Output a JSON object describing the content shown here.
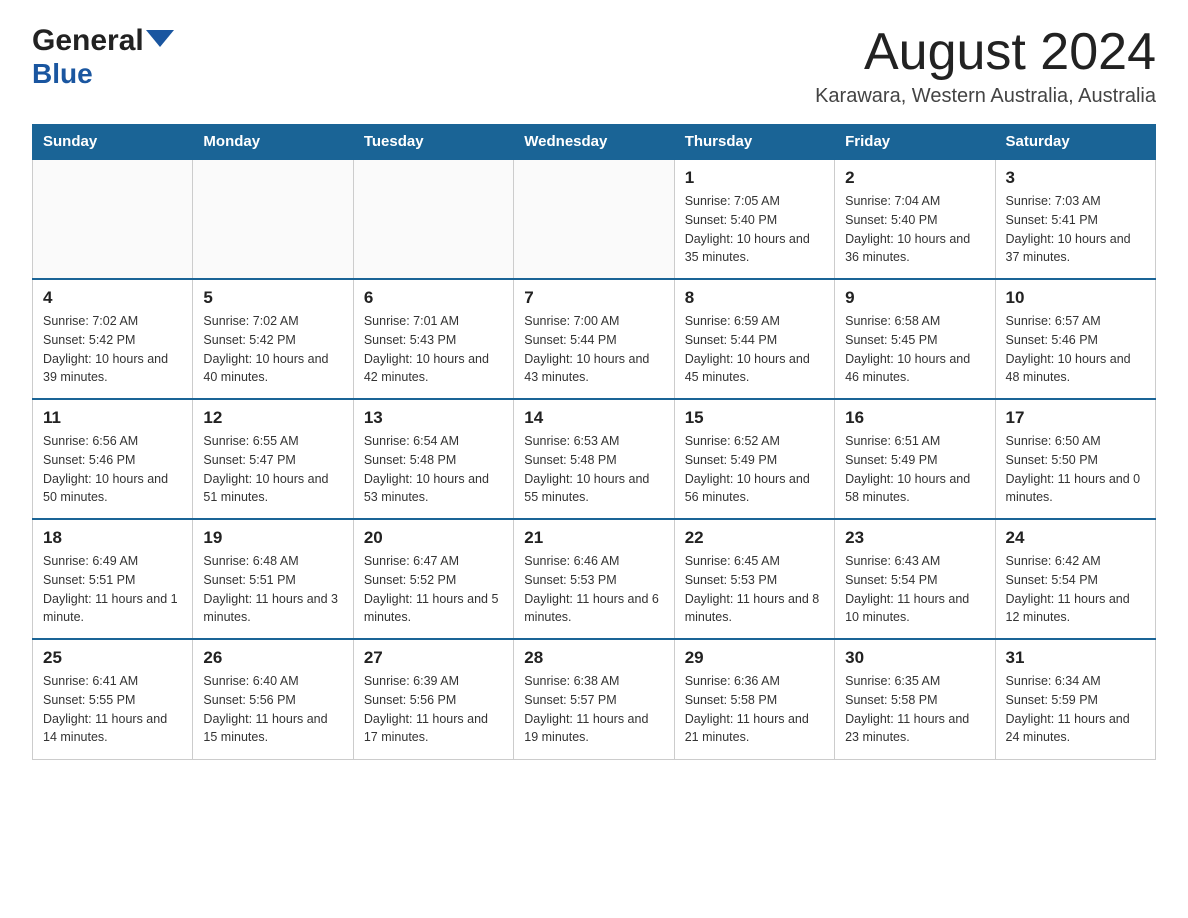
{
  "header": {
    "logo_general": "General",
    "logo_blue": "Blue",
    "main_title": "August 2024",
    "subtitle": "Karawara, Western Australia, Australia"
  },
  "calendar": {
    "days_of_week": [
      "Sunday",
      "Monday",
      "Tuesday",
      "Wednesday",
      "Thursday",
      "Friday",
      "Saturday"
    ],
    "weeks": [
      [
        {
          "day": "",
          "sunrise": "",
          "sunset": "",
          "daylight": ""
        },
        {
          "day": "",
          "sunrise": "",
          "sunset": "",
          "daylight": ""
        },
        {
          "day": "",
          "sunrise": "",
          "sunset": "",
          "daylight": ""
        },
        {
          "day": "",
          "sunrise": "",
          "sunset": "",
          "daylight": ""
        },
        {
          "day": "1",
          "sunrise": "Sunrise: 7:05 AM",
          "sunset": "Sunset: 5:40 PM",
          "daylight": "Daylight: 10 hours and 35 minutes."
        },
        {
          "day": "2",
          "sunrise": "Sunrise: 7:04 AM",
          "sunset": "Sunset: 5:40 PM",
          "daylight": "Daylight: 10 hours and 36 minutes."
        },
        {
          "day": "3",
          "sunrise": "Sunrise: 7:03 AM",
          "sunset": "Sunset: 5:41 PM",
          "daylight": "Daylight: 10 hours and 37 minutes."
        }
      ],
      [
        {
          "day": "4",
          "sunrise": "Sunrise: 7:02 AM",
          "sunset": "Sunset: 5:42 PM",
          "daylight": "Daylight: 10 hours and 39 minutes."
        },
        {
          "day": "5",
          "sunrise": "Sunrise: 7:02 AM",
          "sunset": "Sunset: 5:42 PM",
          "daylight": "Daylight: 10 hours and 40 minutes."
        },
        {
          "day": "6",
          "sunrise": "Sunrise: 7:01 AM",
          "sunset": "Sunset: 5:43 PM",
          "daylight": "Daylight: 10 hours and 42 minutes."
        },
        {
          "day": "7",
          "sunrise": "Sunrise: 7:00 AM",
          "sunset": "Sunset: 5:44 PM",
          "daylight": "Daylight: 10 hours and 43 minutes."
        },
        {
          "day": "8",
          "sunrise": "Sunrise: 6:59 AM",
          "sunset": "Sunset: 5:44 PM",
          "daylight": "Daylight: 10 hours and 45 minutes."
        },
        {
          "day": "9",
          "sunrise": "Sunrise: 6:58 AM",
          "sunset": "Sunset: 5:45 PM",
          "daylight": "Daylight: 10 hours and 46 minutes."
        },
        {
          "day": "10",
          "sunrise": "Sunrise: 6:57 AM",
          "sunset": "Sunset: 5:46 PM",
          "daylight": "Daylight: 10 hours and 48 minutes."
        }
      ],
      [
        {
          "day": "11",
          "sunrise": "Sunrise: 6:56 AM",
          "sunset": "Sunset: 5:46 PM",
          "daylight": "Daylight: 10 hours and 50 minutes."
        },
        {
          "day": "12",
          "sunrise": "Sunrise: 6:55 AM",
          "sunset": "Sunset: 5:47 PM",
          "daylight": "Daylight: 10 hours and 51 minutes."
        },
        {
          "day": "13",
          "sunrise": "Sunrise: 6:54 AM",
          "sunset": "Sunset: 5:48 PM",
          "daylight": "Daylight: 10 hours and 53 minutes."
        },
        {
          "day": "14",
          "sunrise": "Sunrise: 6:53 AM",
          "sunset": "Sunset: 5:48 PM",
          "daylight": "Daylight: 10 hours and 55 minutes."
        },
        {
          "day": "15",
          "sunrise": "Sunrise: 6:52 AM",
          "sunset": "Sunset: 5:49 PM",
          "daylight": "Daylight: 10 hours and 56 minutes."
        },
        {
          "day": "16",
          "sunrise": "Sunrise: 6:51 AM",
          "sunset": "Sunset: 5:49 PM",
          "daylight": "Daylight: 10 hours and 58 minutes."
        },
        {
          "day": "17",
          "sunrise": "Sunrise: 6:50 AM",
          "sunset": "Sunset: 5:50 PM",
          "daylight": "Daylight: 11 hours and 0 minutes."
        }
      ],
      [
        {
          "day": "18",
          "sunrise": "Sunrise: 6:49 AM",
          "sunset": "Sunset: 5:51 PM",
          "daylight": "Daylight: 11 hours and 1 minute."
        },
        {
          "day": "19",
          "sunrise": "Sunrise: 6:48 AM",
          "sunset": "Sunset: 5:51 PM",
          "daylight": "Daylight: 11 hours and 3 minutes."
        },
        {
          "day": "20",
          "sunrise": "Sunrise: 6:47 AM",
          "sunset": "Sunset: 5:52 PM",
          "daylight": "Daylight: 11 hours and 5 minutes."
        },
        {
          "day": "21",
          "sunrise": "Sunrise: 6:46 AM",
          "sunset": "Sunset: 5:53 PM",
          "daylight": "Daylight: 11 hours and 6 minutes."
        },
        {
          "day": "22",
          "sunrise": "Sunrise: 6:45 AM",
          "sunset": "Sunset: 5:53 PM",
          "daylight": "Daylight: 11 hours and 8 minutes."
        },
        {
          "day": "23",
          "sunrise": "Sunrise: 6:43 AM",
          "sunset": "Sunset: 5:54 PM",
          "daylight": "Daylight: 11 hours and 10 minutes."
        },
        {
          "day": "24",
          "sunrise": "Sunrise: 6:42 AM",
          "sunset": "Sunset: 5:54 PM",
          "daylight": "Daylight: 11 hours and 12 minutes."
        }
      ],
      [
        {
          "day": "25",
          "sunrise": "Sunrise: 6:41 AM",
          "sunset": "Sunset: 5:55 PM",
          "daylight": "Daylight: 11 hours and 14 minutes."
        },
        {
          "day": "26",
          "sunrise": "Sunrise: 6:40 AM",
          "sunset": "Sunset: 5:56 PM",
          "daylight": "Daylight: 11 hours and 15 minutes."
        },
        {
          "day": "27",
          "sunrise": "Sunrise: 6:39 AM",
          "sunset": "Sunset: 5:56 PM",
          "daylight": "Daylight: 11 hours and 17 minutes."
        },
        {
          "day": "28",
          "sunrise": "Sunrise: 6:38 AM",
          "sunset": "Sunset: 5:57 PM",
          "daylight": "Daylight: 11 hours and 19 minutes."
        },
        {
          "day": "29",
          "sunrise": "Sunrise: 6:36 AM",
          "sunset": "Sunset: 5:58 PM",
          "daylight": "Daylight: 11 hours and 21 minutes."
        },
        {
          "day": "30",
          "sunrise": "Sunrise: 6:35 AM",
          "sunset": "Sunset: 5:58 PM",
          "daylight": "Daylight: 11 hours and 23 minutes."
        },
        {
          "day": "31",
          "sunrise": "Sunrise: 6:34 AM",
          "sunset": "Sunset: 5:59 PM",
          "daylight": "Daylight: 11 hours and 24 minutes."
        }
      ]
    ]
  }
}
